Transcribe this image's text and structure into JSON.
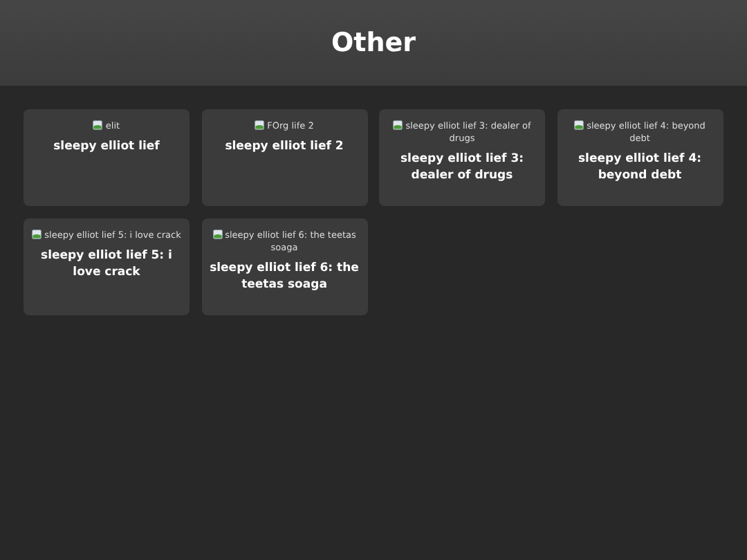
{
  "header": {
    "title": "Other"
  },
  "cards": [
    {
      "image_alt": "elit",
      "title": "sleepy elliot lief"
    },
    {
      "image_alt": "FOrg life 2",
      "title": "sleepy elliot lief 2"
    },
    {
      "image_alt": "sleepy elliot lief 3: dealer of drugs",
      "title": "sleepy elliot lief 3: dealer of drugs"
    },
    {
      "image_alt": "sleepy elliot lief 4: beyond debt",
      "title": "sleepy elliot lief 4: beyond debt"
    },
    {
      "image_alt": "sleepy elliot lief 5: i love crack",
      "title": "sleepy elliot lief 5: i love crack"
    },
    {
      "image_alt": "sleepy elliot lief 6: the teetas soaga",
      "title": "sleepy elliot lief 6: the teetas soaga"
    }
  ]
}
